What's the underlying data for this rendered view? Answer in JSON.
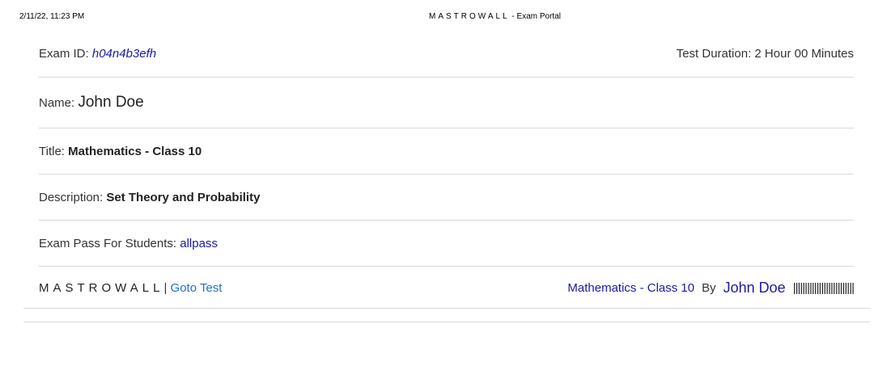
{
  "print_header": {
    "date": "2/11/22, 11:23 PM",
    "brand": "MASTROWALL",
    "suffix": " - Exam Portal"
  },
  "exam": {
    "id_label": "Exam ID: ",
    "id_value": "h04n4b3efh",
    "duration_label": "Test Duration: ",
    "duration_value": "2 Hour 00 Minutes",
    "name_label": "Name: ",
    "name_value": "John Doe",
    "title_label": "Title: ",
    "title_value": "Mathematics - Class 10",
    "description_label": "Description: ",
    "description_value": "Set Theory and Probability",
    "pass_label": "Exam Pass For Students: ",
    "pass_value": "allpass"
  },
  "footer": {
    "brand": "MASTROWALL",
    "separator": "|",
    "goto_label": "Goto Test",
    "course": "Mathematics - Class 10",
    "by": "By",
    "author": "John Doe",
    "barcode": "||||||||||||||||||||||||||"
  }
}
